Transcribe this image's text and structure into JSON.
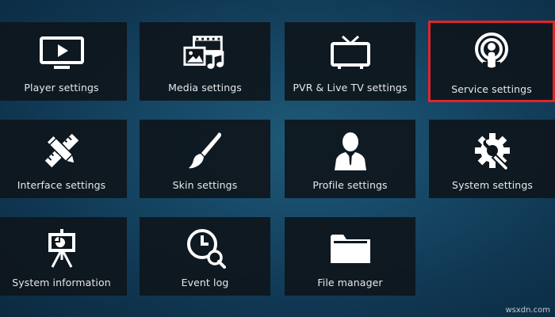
{
  "tiles": [
    {
      "label": "Player settings",
      "icon": "monitor-play-icon"
    },
    {
      "label": "Media settings",
      "icon": "media-icon"
    },
    {
      "label": "PVR & Live TV settings",
      "icon": "tv-antenna-icon"
    },
    {
      "label": "Service settings",
      "icon": "podcast-broadcast-icon",
      "focused": true
    },
    {
      "label": "Interface settings",
      "icon": "pencil-ruler-icon"
    },
    {
      "label": "Skin settings",
      "icon": "paintbrush-icon"
    },
    {
      "label": "Profile settings",
      "icon": "profile-person-icon"
    },
    {
      "label": "System settings",
      "icon": "gear-wrench-icon"
    },
    {
      "label": "System information",
      "icon": "presentation-board-icon"
    },
    {
      "label": "Event log",
      "icon": "clock-search-icon"
    },
    {
      "label": "File manager",
      "icon": "folder-icon"
    }
  ],
  "watermark": "wsxdn.com",
  "colors": {
    "background": "#164866",
    "tile": "#0e161c",
    "focus_border": "#e0242a",
    "text": "#e6e9eb"
  }
}
